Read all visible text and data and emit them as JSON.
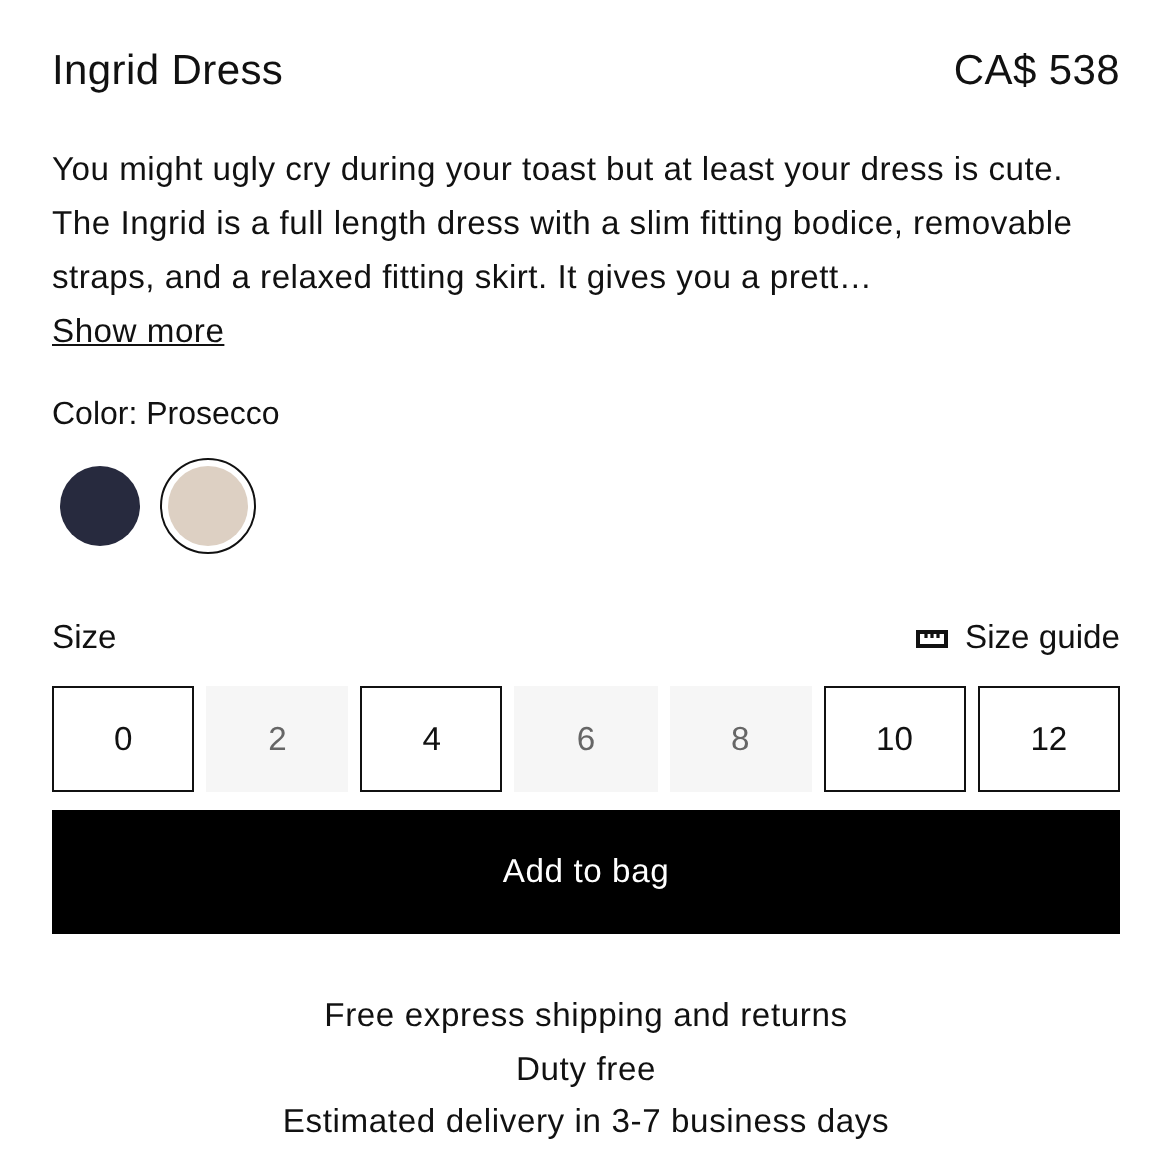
{
  "product": {
    "name": "Ingrid Dress",
    "price": "CA$ 538"
  },
  "description": {
    "text": "You might ugly cry during your toast but at least your dress is cute. The Ingrid is a full length dress with a slim fitting bodice, removable straps, and a relaxed fitting skirt. It gives you a prett…",
    "link": "Show more"
  },
  "color": {
    "label": "Color: Prosecco",
    "swatches": [
      {
        "color": "#272a3e",
        "selected": false
      },
      {
        "color": "#ddd0c3",
        "selected": true
      }
    ]
  },
  "size": {
    "label": "Size",
    "guide": "Size guide",
    "options": [
      {
        "label": "0",
        "available": true,
        "selected": false
      },
      {
        "label": "2",
        "available": false,
        "selected": false
      },
      {
        "label": "4",
        "available": true,
        "selected": false
      },
      {
        "label": "6",
        "available": false,
        "selected": false
      },
      {
        "label": "8",
        "available": false,
        "selected": false
      },
      {
        "label": "10",
        "available": true,
        "selected": false
      },
      {
        "label": "12",
        "available": true,
        "selected": false
      }
    ]
  },
  "add_button": "Add to bag",
  "shipping_notes": [
    "Free express shipping and returns",
    "Duty free",
    "Estimated delivery in 3-7 business days"
  ]
}
